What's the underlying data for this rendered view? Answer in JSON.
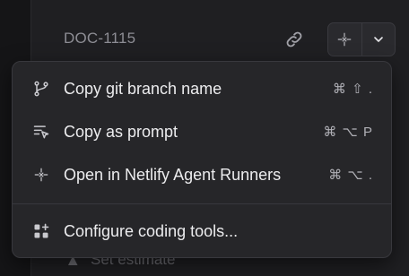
{
  "header": {
    "doc_id": "DOC-1115"
  },
  "menu": {
    "items": [
      {
        "label": "Copy git branch name",
        "shortcut": "⌘ ⇧ .",
        "icon": "git-branch-icon"
      },
      {
        "label": "Copy as prompt",
        "shortcut": "⌘ ⌥ P",
        "icon": "prompt-icon"
      },
      {
        "label": "Open in Netlify Agent Runners",
        "shortcut": "⌘ ⌥ .",
        "icon": "netlify-icon"
      }
    ],
    "footer_item": {
      "label": "Configure coding tools...",
      "icon": "apps-add-icon"
    }
  },
  "background": {
    "partial_label": "Set estimate"
  },
  "colors": {
    "menu_bg": "#262629",
    "panel_bg": "#1f1f22",
    "text": "#ececee",
    "muted": "#8d8d94"
  }
}
